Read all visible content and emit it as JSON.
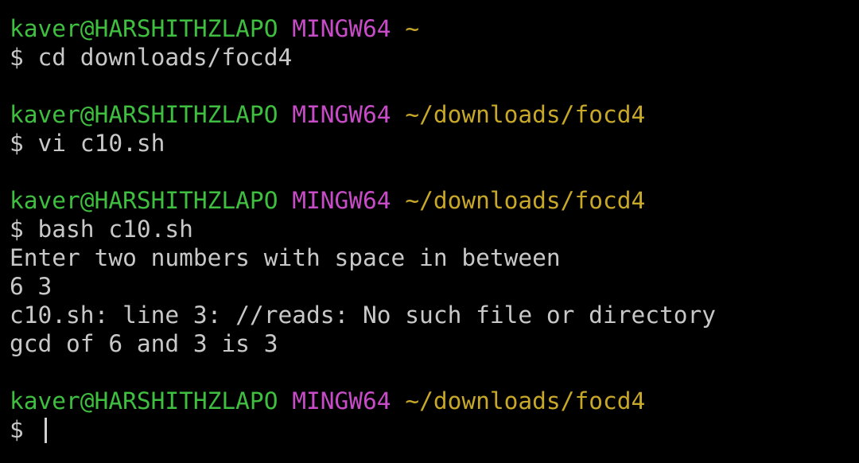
{
  "terminal": {
    "blocks": [
      {
        "prompt": {
          "user_host": "kaver@HARSHITHZLAPO",
          "system": "MINGW64",
          "path": "~"
        },
        "command": "$ cd downloads/focd4",
        "output": []
      },
      {
        "prompt": {
          "user_host": "kaver@HARSHITHZLAPO",
          "system": "MINGW64",
          "path": "~/downloads/focd4"
        },
        "command": "$ vi c10.sh",
        "output": []
      },
      {
        "prompt": {
          "user_host": "kaver@HARSHITHZLAPO",
          "system": "MINGW64",
          "path": "~/downloads/focd4"
        },
        "command": "$ bash c10.sh",
        "output": [
          "Enter two numbers with space in between",
          "6 3",
          "c10.sh: line 3: //reads: No such file or directory",
          "gcd of 6 and 3 is 3"
        ]
      },
      {
        "prompt": {
          "user_host": "kaver@HARSHITHZLAPO",
          "system": "MINGW64",
          "path": "~/downloads/focd4"
        },
        "command": "$ ",
        "output": []
      }
    ]
  },
  "colors": {
    "background": "#000000",
    "user_host": "#3fbf3f",
    "system": "#c84cc8",
    "path": "#c8a828",
    "text": "#c8c8c8"
  }
}
